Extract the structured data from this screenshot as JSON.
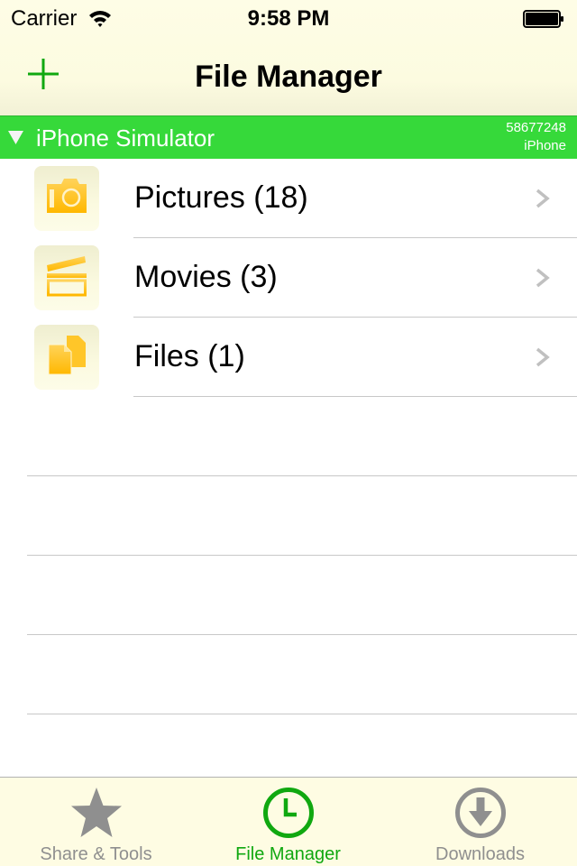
{
  "status_bar": {
    "carrier": "Carrier",
    "time": "9:58 PM",
    "wifi_icon": "wifi-icon",
    "battery_icon": "battery-full-icon"
  },
  "nav_bar": {
    "title": "File Manager",
    "add_icon": "plus-icon"
  },
  "device_section": {
    "name": "iPhone Simulator",
    "id": "58677248",
    "type": "iPhone",
    "expanded": true,
    "disclosure_icon": "triangle-down-icon"
  },
  "list": {
    "items": [
      {
        "label": "Pictures (18)",
        "icon": "camera-icon"
      },
      {
        "label": "Movies (3)",
        "icon": "clapperboard-icon"
      },
      {
        "label": "Files (1)",
        "icon": "documents-icon"
      }
    ],
    "chevron_icon": "chevron-right-icon"
  },
  "tab_bar": {
    "tabs": [
      {
        "label": "Share & Tools",
        "icon": "star-icon",
        "active": false
      },
      {
        "label": "File Manager",
        "icon": "clock-icon",
        "active": true
      },
      {
        "label": "Downloads",
        "icon": "download-icon",
        "active": false
      }
    ]
  },
  "colors": {
    "accent": "#10a810",
    "section_header": "#36d93a",
    "bar_background": "#fefce3",
    "inactive_tab": "#8f8f8f",
    "folder_icon": "#ffbf10"
  }
}
